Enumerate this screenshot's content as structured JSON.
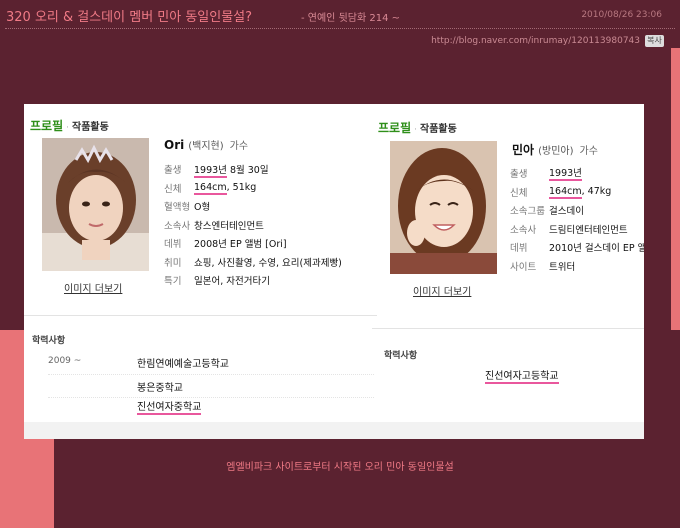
{
  "post": {
    "title": "320 오리 & 걸스데이 멤버 민아 동일인물설?",
    "category": "- 연예인 뒷담화 214 ~",
    "date": "2010/08/26 23:06",
    "url": "http://blog.naver.com/inrumay/120113980743",
    "copy_label": "복사",
    "caption": "엠엘비파크 사이트로부터 시작된 오리 민아 동일인물설"
  },
  "left": {
    "tab_main": "프로필",
    "tab_sep": "·",
    "tab_sub": "작품활동",
    "name": "Ori",
    "realname": "(백지현)",
    "job": "가수",
    "photo_link": "이미지 더보기",
    "info": [
      {
        "label": "출생",
        "value": "1993년 8월 30일",
        "hl": "1993년"
      },
      {
        "label": "신체",
        "value": "164cm, 51kg",
        "hl": "164cm"
      },
      {
        "label": "혈액형",
        "value": "O형"
      },
      {
        "label": "소속사",
        "value": "창스엔터테인먼트"
      },
      {
        "label": "데뷔",
        "value": "2008년 EP 앨범 [Ori]"
      },
      {
        "label": "취미",
        "value": "쇼핑, 사진촬영, 수영, 요리(제과제빵)"
      },
      {
        "label": "특기",
        "value": "일본어, 자전거타기"
      }
    ],
    "edu_title": "학력사항",
    "edu_year": "2009 ~",
    "edu": [
      "한림연예예술고등학교",
      "봉은중학교",
      "진선여자중학교"
    ]
  },
  "right": {
    "tab_main": "프로필",
    "tab_sep": "·",
    "tab_sub": "작품활동",
    "name": "민아",
    "realname": "(방민아)",
    "job": "가수",
    "photo_link": "이미지 더보기",
    "info": [
      {
        "label": "출생",
        "value": "1993년",
        "hl": "1993년"
      },
      {
        "label": "신체",
        "value": "164cm, 47kg",
        "hl": "164cm"
      },
      {
        "label": "소속그룹",
        "value": "걸스데이"
      },
      {
        "label": "소속사",
        "value": "드림티엔터테인먼트"
      },
      {
        "label": "데뷔",
        "value": "2010년 걸스데이 EP 앨"
      },
      {
        "label": "사이트",
        "value": "트위터",
        "link": true
      }
    ],
    "edu_title": "학력사항",
    "edu": [
      "진선여자고등학교"
    ]
  },
  "colors": {
    "background": "#5b2230",
    "accent_pink": "#e87377",
    "title_pink": "#f07a86",
    "tab_green": "#2f8f1a",
    "highlight": "#e9579d"
  }
}
